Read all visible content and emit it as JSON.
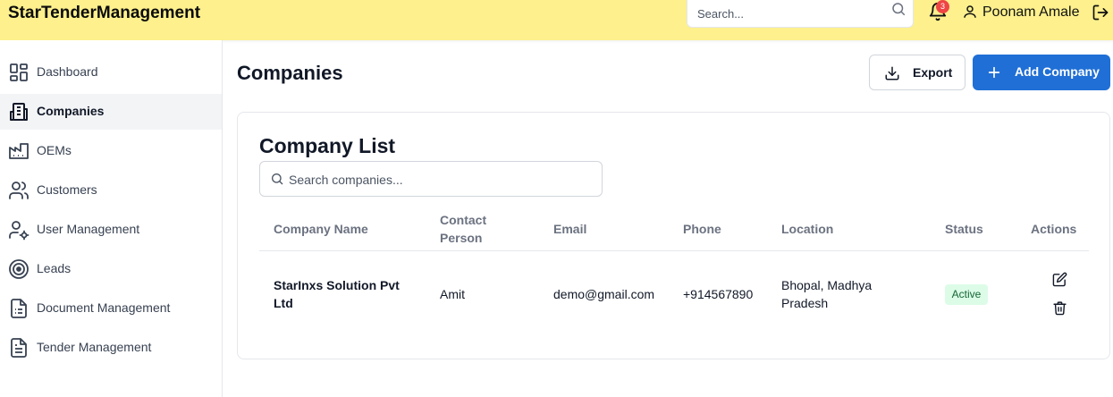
{
  "app": {
    "brand": "StarTenderManagement"
  },
  "header": {
    "search_placeholder": "Search...",
    "notifications_count": "3",
    "user_name": "Poonam Amale"
  },
  "sidebar": {
    "items": [
      {
        "label": "Dashboard",
        "icon": "dashboard-icon"
      },
      {
        "label": "Companies",
        "icon": "building-icon",
        "active": true
      },
      {
        "label": "OEMs",
        "icon": "factory-icon"
      },
      {
        "label": "Customers",
        "icon": "users-icon"
      },
      {
        "label": "User Management",
        "icon": "user-gear-icon"
      },
      {
        "label": "Leads",
        "icon": "target-icon"
      },
      {
        "label": "Document Management",
        "icon": "document-icon"
      },
      {
        "label": "Tender Management",
        "icon": "file-text-icon"
      }
    ]
  },
  "main": {
    "title": "Companies",
    "export_label": "Export",
    "add_label": "Add Company",
    "card_title": "Company List",
    "search_placeholder": "Search companies...",
    "table": {
      "headers": [
        "Company Name",
        "Contact\nPerson",
        "Email",
        "Phone",
        "Location",
        "Status",
        "Actions"
      ],
      "rows": [
        {
          "company": "StarInxs Solution Pvt Ltd",
          "contact": "Amit",
          "email": "demo@gmail.com",
          "phone": "+914567890",
          "location": "Bhopal, Madhya Pradesh",
          "status": "Active"
        }
      ]
    }
  },
  "colors": {
    "header_bg": "#fdf08d",
    "primary": "#1f6fd6",
    "active_status_bg": "#dcfce7",
    "badge": "#ef4444"
  }
}
